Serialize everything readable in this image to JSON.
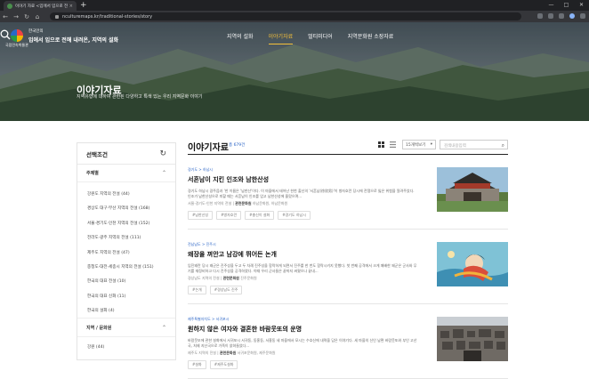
{
  "browser": {
    "tab_title": "이야기 자료 <입에서 입으로 전해...",
    "tab_close": "×",
    "new_tab": "+",
    "url": "nculturemaps.kr/traditional-stories/story",
    "window_controls": [
      "—",
      "□",
      "✕"
    ]
  },
  "site": {
    "logo_text": "국립민속박물관",
    "sub": "한국인의",
    "title": "입에서 입으로 전해 내려온, 지역의 설화"
  },
  "gnb": {
    "items": [
      "지역의 설화",
      "이야기자료",
      "멀티미디어",
      "지역문화원 소장자료"
    ],
    "active_index": 1
  },
  "hero": {
    "title": "이야기자료",
    "desc": "지역유형에 대하여 관련된 다양하고 특색 있는 우리 지역문화 이야기"
  },
  "filters": {
    "title": "선택조건",
    "section_theme": "주제별",
    "theme_items": [
      "강원도 지역의 전설 (44)",
      "경상도 대구·부산 지역의 전설 (168)",
      "서울·경기도·인천 지역의 전설 (152)",
      "전라도·광주 지역의 전설 (111)",
      "제주도 지역의 전설 (47)",
      "충청도·대전·세종시 지역의 전설 (151)",
      "한국의 대표 전설 (10)",
      "한국의 대표 신화 (11)",
      "한국의 설화 (4)"
    ],
    "section_region": "지역 / 문화원",
    "region_items": [
      "강원 (44)"
    ]
  },
  "main": {
    "title": "이야기자료",
    "count": "총 679건",
    "sort": "15개씩보기",
    "search_placeholder": "검색내용입력",
    "cards": [
      {
        "category": "경기도 > 하남시",
        "title": "서흔남이 지킨 인조와 남한산성",
        "desc": "경기도 하남시 광주읍과 '한 이름은 '남한산'이다. 이 마을에서 태어난 한천 출신의 '서흔남(徐欣男)'이 병자호란 당시에 전쟁으로 잃은 위험을 알려주었다. 인조가 남한산성으로 피할 때는 서흔남이 인조를 업고 남한산성에 올랐으며...",
        "meta_region": "서울·경기도·인천 지역의 전설",
        "meta_org_label": "관련문화원",
        "meta_org": "하남문화원, 하남문화원",
        "tags": [
          "#남한산성",
          "#병자호란",
          "#충신이 설화",
          "#경기도 하남시"
        ]
      },
      {
        "category": "전남남도 > 진주시",
        "title": "왜장을 껴안고 남강에 뛰어든 논개",
        "desc": "임진왜란 당시 왜군은 진주성을 두고 두 차례 진주성을 함락하게 되면서 진주를 한 번도 함락시키지 못했다. 첫 번째 공격에서 크게 패배한 왜군은 군사와 무기를 재정비하고 다시 진주성을 공격하였다. 이때 우리 군사들은 끝까지 싸웠으나 끝내...",
        "meta_region": "경상남도 지역의 전설",
        "meta_org_label": "관련문화원",
        "meta_org": "진주문화원",
        "tags": [
          "#논개",
          "#경상남도 진주"
        ]
      },
      {
        "category": "제주특별자치도 > 서귀포시",
        "title": "원하지 않은 여자와 결혼한 바람웃또의 운명",
        "desc": "바람웃또에 관한 설화에서 서귀포시 서귀동, 동홍동, 서홍동 세 마을에서 모시는 수호신에 내력을 담은 이야기다. 세 마을의 신인 남편 바람웃또와 부인 고산국, 처제 지산국으로 가족이 얽혀들었다...",
        "meta_region": "제주도 지역의 전설",
        "meta_org_label": "관련문화원",
        "meta_org": "서귀포문화원, 제주문화원",
        "tags": [
          "#설화",
          "#제주도설화"
        ]
      }
    ]
  }
}
